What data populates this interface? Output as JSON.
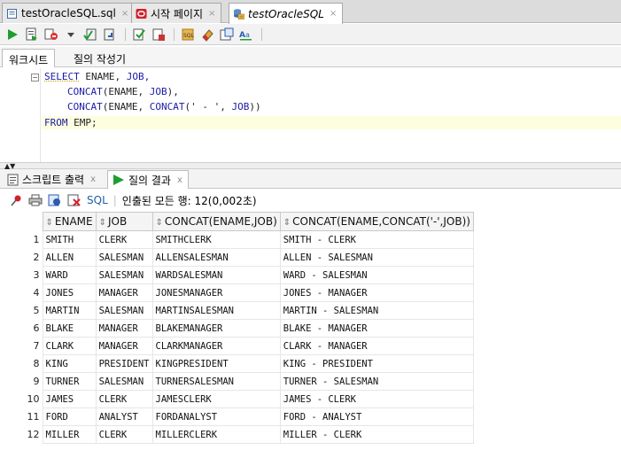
{
  "editor_tabs": [
    {
      "label": "testOracleSQL.sql",
      "icon": "sql-file-icon",
      "italic": false
    },
    {
      "label": "시작 페이지",
      "icon": "oracle-icon",
      "italic": false
    },
    {
      "label": "testOracleSQL",
      "icon": "database-connection-icon",
      "italic": true
    }
  ],
  "close_glyph": "×",
  "worksheet_tabs": [
    "워크시트",
    "질의 작성기"
  ],
  "code_lines": {
    "l1_kw": "SELECT",
    "l1_rest": " ENAME, ",
    "l1_job": "JOB,",
    "l2_fn": "CONCAT",
    "l2_rest": "(ENAME, ",
    "l2_job": "JOB",
    "l2_end": "),",
    "l3_fn1": "CONCAT",
    "l3_a": "(ENAME, ",
    "l3_fn2": "CONCAT",
    "l3_str": "(' - ', ",
    "l3_job": "JOB",
    "l3_end": "))",
    "l4_kw": "FROM",
    "l4_rest": " EMP;"
  },
  "output_tabs": [
    {
      "label": "스크립트 출력",
      "close": "x"
    },
    {
      "label": "질의 결과",
      "close": "x"
    }
  ],
  "results_toolbar": {
    "sql_label": "SQL",
    "status": "인출된 모든 행: 12(0,002초)"
  },
  "columns": [
    "ENAME",
    "JOB",
    "CONCAT(ENAME,JOB)",
    "CONCAT(ENAME,CONCAT('-',JOB))"
  ],
  "rows": [
    {
      "n": "1",
      "ename": "SMITH",
      "job": "CLERK",
      "c1": "SMITHCLERK",
      "c2": "SMITH - CLERK"
    },
    {
      "n": "2",
      "ename": "ALLEN",
      "job": "SALESMAN",
      "c1": "ALLENSALESMAN",
      "c2": "ALLEN - SALESMAN"
    },
    {
      "n": "3",
      "ename": "WARD",
      "job": "SALESMAN",
      "c1": "WARDSALESMAN",
      "c2": "WARD - SALESMAN"
    },
    {
      "n": "4",
      "ename": "JONES",
      "job": "MANAGER",
      "c1": "JONESMANAGER",
      "c2": "JONES - MANAGER"
    },
    {
      "n": "5",
      "ename": "MARTIN",
      "job": "SALESMAN",
      "c1": "MARTINSALESMAN",
      "c2": "MARTIN - SALESMAN"
    },
    {
      "n": "6",
      "ename": "BLAKE",
      "job": "MANAGER",
      "c1": "BLAKEMANAGER",
      "c2": "BLAKE - MANAGER"
    },
    {
      "n": "7",
      "ename": "CLARK",
      "job": "MANAGER",
      "c1": "CLARKMANAGER",
      "c2": "CLARK - MANAGER"
    },
    {
      "n": "8",
      "ename": "KING",
      "job": "PRESIDENT",
      "c1": "KINGPRESIDENT",
      "c2": "KING - PRESIDENT"
    },
    {
      "n": "9",
      "ename": "TURNER",
      "job": "SALESMAN",
      "c1": "TURNERSALESMAN",
      "c2": "TURNER - SALESMAN"
    },
    {
      "n": "10",
      "ename": "JAMES",
      "job": "CLERK",
      "c1": "JAMESCLERK",
      "c2": "JAMES - CLERK"
    },
    {
      "n": "11",
      "ename": "FORD",
      "job": "ANALYST",
      "c1": "FORDANALYST",
      "c2": "FORD - ANALYST"
    },
    {
      "n": "12",
      "ename": "MILLER",
      "job": "CLERK",
      "c1": "MILLERCLERK",
      "c2": "MILLER - CLERK"
    }
  ],
  "colors": {
    "keyword": "#1a1aa6",
    "link": "#1f5fa8",
    "run_green": "#1e9e2e",
    "oracle_red": "#d3202a"
  }
}
